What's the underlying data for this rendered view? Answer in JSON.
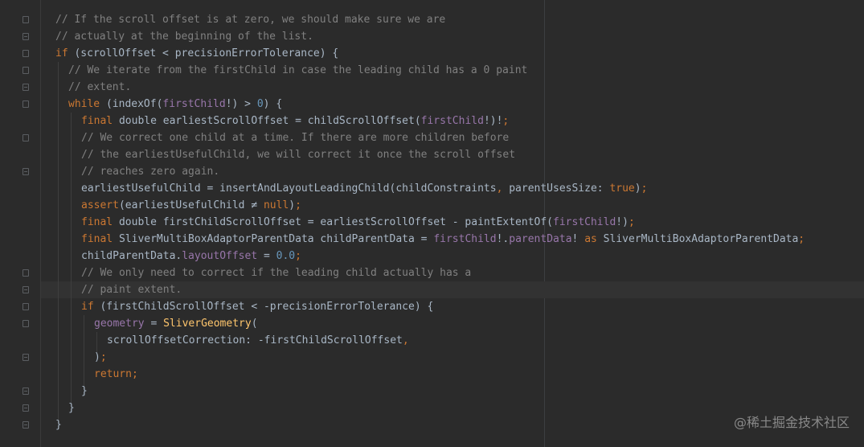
{
  "editor": {
    "theme_colors": {
      "background": "#2b2b2b",
      "comment": "#808080",
      "keyword": "#cc7832",
      "field": "#9876aa",
      "number": "#6897bb",
      "function": "#ffc66d",
      "text": "#a9b7c6"
    },
    "lines": [
      {
        "tokens": [
          {
            "c": "comment",
            "t": "// If the scroll offset is at zero, we should make sure we are"
          }
        ]
      },
      {
        "tokens": [
          {
            "c": "comment",
            "t": "// actually at the beginning of the list."
          }
        ]
      },
      {
        "tokens": [
          {
            "c": "kw",
            "t": "if"
          },
          {
            "c": "plain",
            "t": " (scrollOffset < precisionErrorTolerance) {"
          }
        ]
      },
      {
        "tokens": [
          {
            "c": "comment",
            "t": "// We iterate from the firstChild in case the leading child has a 0 paint"
          }
        ]
      },
      {
        "tokens": [
          {
            "c": "comment",
            "t": "// extent."
          }
        ]
      },
      {
        "tokens": [
          {
            "c": "kw",
            "t": "while"
          },
          {
            "c": "plain",
            "t": " (indexOf("
          },
          {
            "c": "field",
            "t": "firstChild"
          },
          {
            "c": "plain",
            "t": "!) > "
          },
          {
            "c": "num",
            "t": "0"
          },
          {
            "c": "plain",
            "t": ") {"
          }
        ]
      },
      {
        "tokens": [
          {
            "c": "kw",
            "t": "final"
          },
          {
            "c": "plain",
            "t": " double earliestScrollOffset = childScrollOffset("
          },
          {
            "c": "field",
            "t": "firstChild"
          },
          {
            "c": "plain",
            "t": "!)!"
          },
          {
            "c": "kw",
            "t": ";"
          }
        ]
      },
      {
        "tokens": [
          {
            "c": "comment",
            "t": "// We correct one child at a time. If there are more children before"
          }
        ]
      },
      {
        "tokens": [
          {
            "c": "comment",
            "t": "// the earliestUsefulChild, we will correct it once the scroll offset"
          }
        ]
      },
      {
        "tokens": [
          {
            "c": "comment",
            "t": "// reaches zero again."
          }
        ]
      },
      {
        "tokens": [
          {
            "c": "plain",
            "t": "earliestUsefulChild = insertAndLayoutLeadingChild(childConstraints"
          },
          {
            "c": "kw",
            "t": ", "
          },
          {
            "c": "plain",
            "t": "parentUsesSize: "
          },
          {
            "c": "kw",
            "t": "true"
          },
          {
            "c": "plain",
            "t": ")"
          },
          {
            "c": "kw",
            "t": ";"
          }
        ]
      },
      {
        "tokens": [
          {
            "c": "kw",
            "t": "assert"
          },
          {
            "c": "plain",
            "t": "(earliestUsefulChild ≠ "
          },
          {
            "c": "kw",
            "t": "null"
          },
          {
            "c": "plain",
            "t": ")"
          },
          {
            "c": "kw",
            "t": ";"
          }
        ]
      },
      {
        "tokens": [
          {
            "c": "kw",
            "t": "final"
          },
          {
            "c": "plain",
            "t": " double firstChildScrollOffset = earliestScrollOffset - paintExtentOf("
          },
          {
            "c": "field",
            "t": "firstChild"
          },
          {
            "c": "plain",
            "t": "!)"
          },
          {
            "c": "kw",
            "t": ";"
          }
        ]
      },
      {
        "tokens": [
          {
            "c": "kw",
            "t": "final"
          },
          {
            "c": "plain",
            "t": " SliverMultiBoxAdaptorParentData childParentData = "
          },
          {
            "c": "field",
            "t": "firstChild"
          },
          {
            "c": "plain",
            "t": "!."
          },
          {
            "c": "field",
            "t": "parentData"
          },
          {
            "c": "plain",
            "t": "! "
          },
          {
            "c": "kw",
            "t": "as"
          },
          {
            "c": "plain",
            "t": " SliverMultiBoxAdaptorParentData"
          },
          {
            "c": "kw",
            "t": ";"
          }
        ]
      },
      {
        "tokens": [
          {
            "c": "plain",
            "t": "childParentData."
          },
          {
            "c": "field",
            "t": "layoutOffset"
          },
          {
            "c": "plain",
            "t": " = "
          },
          {
            "c": "num",
            "t": "0.0"
          },
          {
            "c": "kw",
            "t": ";"
          }
        ]
      },
      {
        "tokens": [
          {
            "c": "comment",
            "t": "// We only need to correct if the leading child actually has a"
          }
        ]
      },
      {
        "tokens": [
          {
            "c": "comment",
            "t": "// paint extent."
          }
        ]
      },
      {
        "tokens": [
          {
            "c": "kw",
            "t": "if"
          },
          {
            "c": "plain",
            "t": " (firstChildScrollOffset < -precisionErrorTolerance) {"
          }
        ]
      },
      {
        "tokens": [
          {
            "c": "field",
            "t": "geometry"
          },
          {
            "c": "plain",
            "t": " = "
          },
          {
            "c": "fn",
            "t": "SliverGeometry"
          },
          {
            "c": "plain",
            "t": "("
          }
        ]
      },
      {
        "tokens": [
          {
            "c": "plain",
            "t": "scrollOffsetCorrection: -firstChildScrollOffset"
          },
          {
            "c": "kw",
            "t": ","
          }
        ]
      },
      {
        "tokens": [
          {
            "c": "plain",
            "t": ")"
          },
          {
            "c": "kw",
            "t": ";"
          }
        ]
      },
      {
        "tokens": [
          {
            "c": "kw",
            "t": "return;"
          }
        ]
      },
      {
        "tokens": [
          {
            "c": "plain",
            "t": "}"
          }
        ]
      },
      {
        "tokens": [
          {
            "c": "plain",
            "t": "}"
          }
        ]
      },
      {
        "tokens": [
          {
            "c": "plain",
            "t": "}"
          }
        ]
      }
    ]
  },
  "watermark": "@稀土掘金技术社区"
}
